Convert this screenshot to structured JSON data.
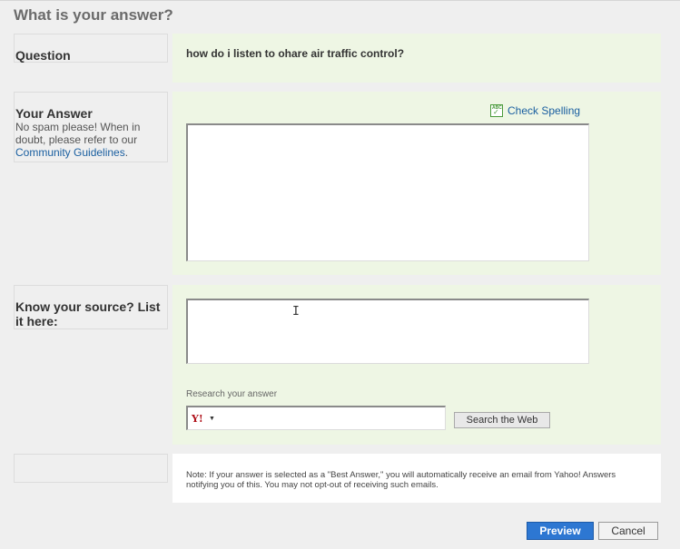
{
  "page": {
    "title": "What is your answer?"
  },
  "question": {
    "label": "Question",
    "text": "how do i listen to ohare air traffic control?"
  },
  "answer": {
    "label": "Your Answer",
    "help_text": "No spam please! When in doubt, please refer to our",
    "guidelines_link": "Community Guidelines",
    "period": ".",
    "check_spelling": "Check Spelling",
    "value": ""
  },
  "source": {
    "label": "Know your source? List it here:",
    "value": "",
    "research_label": "Research your answer",
    "search_value": "",
    "search_button": "Search the Web",
    "search_logo": "Y!"
  },
  "note": "Note: If your answer is selected as a \"Best Answer,\" you will automatically receive an email from Yahoo! Answers notifying you of this. You may not opt-out of receiving such emails.",
  "actions": {
    "preview": "Preview",
    "cancel": "Cancel"
  }
}
